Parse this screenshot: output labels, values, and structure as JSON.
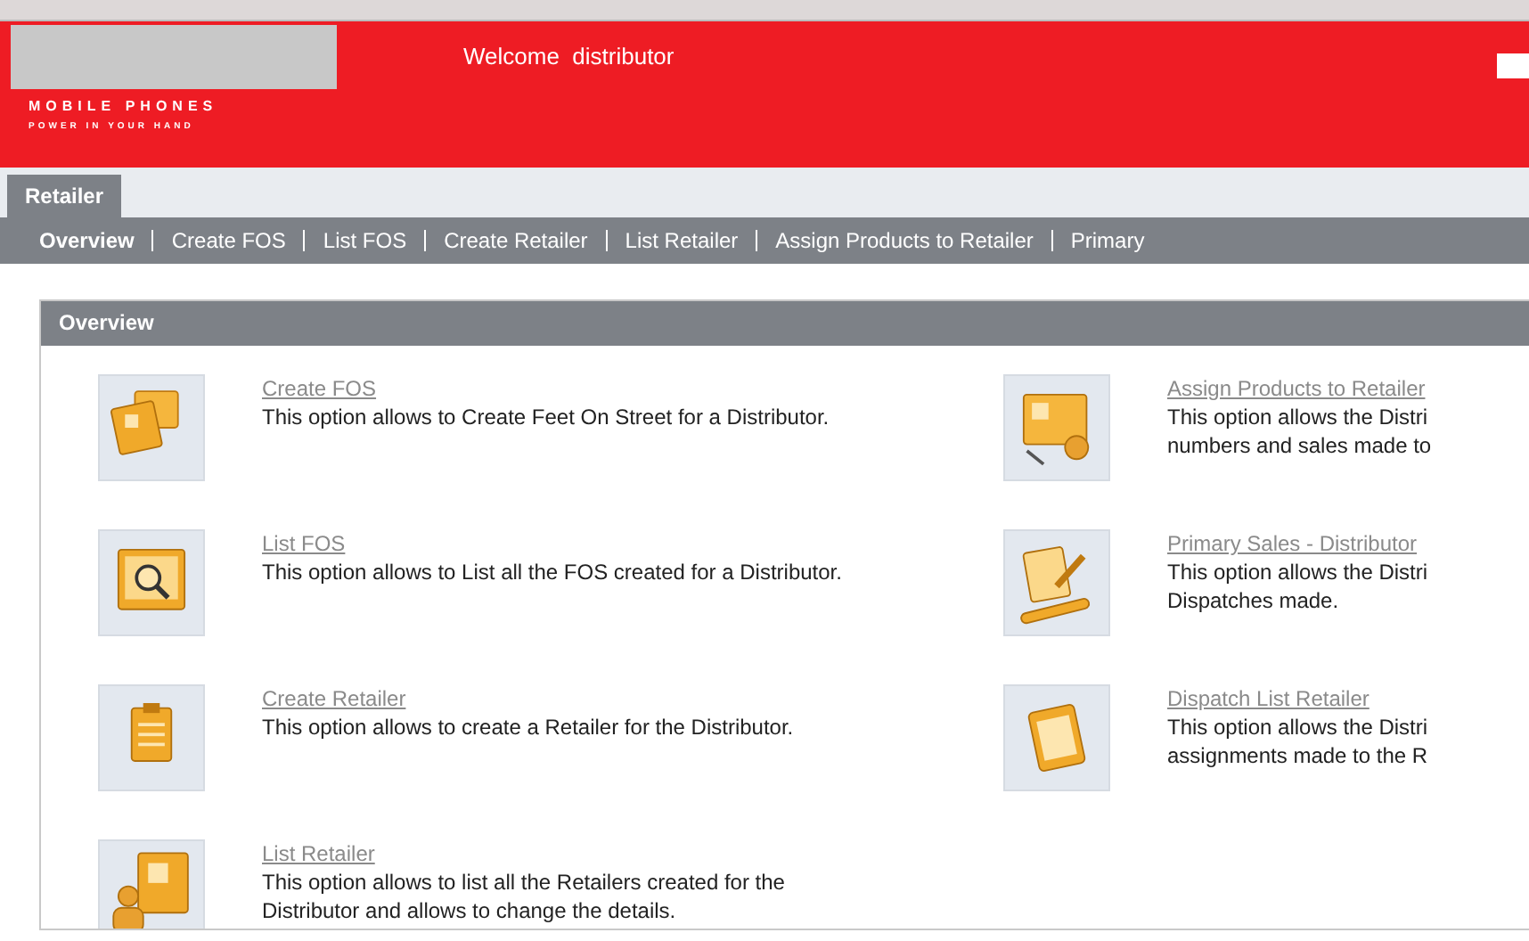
{
  "header": {
    "welcome": "Welcome  distributor",
    "tagline_1": "MOBILE PHONES",
    "tagline_2": "POWER IN YOUR HAND"
  },
  "tabs": [
    {
      "label": "Retailer",
      "selected": true
    }
  ],
  "nav": [
    {
      "label": "Overview",
      "selected": true
    },
    {
      "label": "Create FOS",
      "selected": false
    },
    {
      "label": "List FOS",
      "selected": false
    },
    {
      "label": "Create Retailer",
      "selected": false
    },
    {
      "label": "List Retailer",
      "selected": false
    },
    {
      "label": "Assign Products to Retailer",
      "selected": false
    },
    {
      "label": "Primary",
      "selected": false
    }
  ],
  "panel": {
    "title": "Overview",
    "left": [
      {
        "kind": "cards",
        "title": "Create FOS",
        "text": "This option allows to Create Feet On Street for a Distributor."
      },
      {
        "kind": "search",
        "title": "List FOS",
        "text": "This option allows to List all the FOS created for a Distributor."
      },
      {
        "kind": "clipboard",
        "title": "Create Retailer",
        "text": "This option allows to create a Retailer for the Distributor."
      },
      {
        "kind": "person",
        "title": "List Retailer",
        "text": "This option allows to list all the Retailers created for the Distributor and allows to change the details."
      }
    ],
    "right": [
      {
        "kind": "assign",
        "title": "Assign Products to Retailer",
        "lines": [
          "This option allows the Distri",
          "numbers and sales made to"
        ]
      },
      {
        "kind": "pen",
        "title": "Primary Sales - Distributor",
        "lines": [
          "This option allows the Distri",
          "Dispatches made."
        ]
      },
      {
        "kind": "notepad",
        "title": "Dispatch List Retailer",
        "lines": [
          "This option allows the Distri",
          "assignments made to the R"
        ]
      }
    ]
  }
}
